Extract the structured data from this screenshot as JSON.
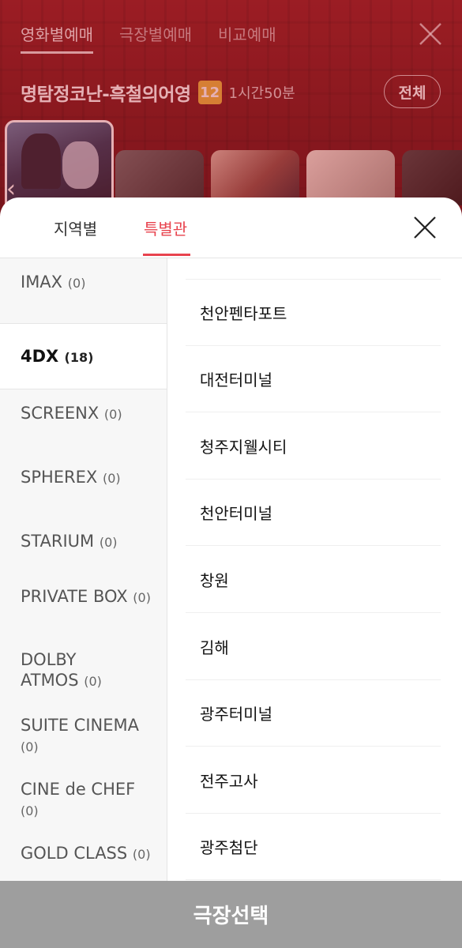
{
  "booking": {
    "tabs": [
      {
        "label": "영화별예매"
      },
      {
        "label": "극장별예매"
      },
      {
        "label": "비교예매"
      }
    ],
    "movie_title": "명탐정코난-흑철의어영",
    "age_rating": "12",
    "runtime": "1시간50분",
    "all_button": "전체",
    "posters": [
      "",
      "",
      "",
      "",
      ""
    ]
  },
  "sheet": {
    "tabs": [
      {
        "label": "지역별"
      },
      {
        "label": "특별관"
      }
    ],
    "active_tab": "특별관",
    "categories": [
      {
        "name": "IMAX",
        "count": "(0)"
      },
      {
        "name": "4DX",
        "count": "(18)"
      },
      {
        "name": "SCREENX",
        "count": "(0)"
      },
      {
        "name": "SPHEREX",
        "count": "(0)"
      },
      {
        "name": "STARIUM",
        "count": "(0)"
      },
      {
        "name": "PRIVATE BOX",
        "count": "(0)"
      },
      {
        "name": "DOLBY ATMOS",
        "count": "(0)"
      },
      {
        "name": "SUITE CINEMA",
        "count": "(0)"
      },
      {
        "name": "CINE de CHEF",
        "count": "(0)"
      },
      {
        "name": "GOLD CLASS",
        "count": "(0)"
      }
    ],
    "active_category": "4DX",
    "theaters": [
      "천안펜타포트",
      "대전터미널",
      "청주지웰시티",
      "천안터미널",
      "창원",
      "김해",
      "광주터미널",
      "전주고사",
      "광주첨단"
    ],
    "select_button": "극장선택"
  },
  "colors": {
    "accent": "#e8434e",
    "header_red": "#8e1e22",
    "button_disabled": "#9e9e9e",
    "age_badge": "#e9b43b"
  },
  "icons": [
    "close-icon",
    "chevron-left-icon"
  ]
}
